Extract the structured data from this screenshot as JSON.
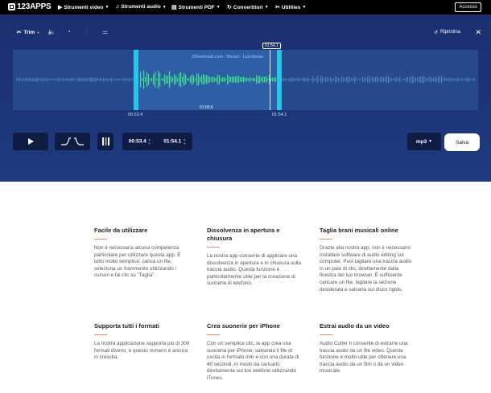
{
  "nav": {
    "logo": "123APPS",
    "items": [
      {
        "icon": "video-icon",
        "label": "Strumenti video"
      },
      {
        "icon": "audio-icon",
        "label": "Strumenti audio"
      },
      {
        "icon": "pdf-icon",
        "label": "Strumenti PDF"
      },
      {
        "icon": "convert-icon",
        "label": "Convertitori"
      },
      {
        "icon": "tools-icon",
        "label": "Utilities"
      }
    ],
    "login": "Accesso"
  },
  "toolbar": {
    "trim_label": "Trim",
    "trim_sup": "+",
    "reset_label": "Ripristina"
  },
  "wave": {
    "watermark": "XDownload.com - Mozart - Lacrimosa",
    "start": "00:53.4",
    "end": "01:54.1",
    "middle": "01:00.6",
    "cursor": "01:54.1"
  },
  "controls": {
    "start_time": "00:53.4",
    "end_time": "01:54.1",
    "format": "mp3",
    "save": "Salva"
  },
  "features": [
    {
      "title": "Facile da utilizzare",
      "text": "Non è necessaria alcuna competenza particolare per utilizzare questa app. È tutto molto semplice: carica un file, seleziona un frammento utilizzando i cursori e fai clic su \"Taglia\"."
    },
    {
      "title": "Dissolvenza in apertura e chiusura",
      "text": "La nostra app consente di applicare una dissolvenza in apertura e in chiusura sulla traccia audio. Questa funzione è particolarmente utile per la creazione di suonerie di telefono."
    },
    {
      "title": "Taglia brani musicali online",
      "text": "Grazie alla nostra app, non è necessario installare software di audio editing sul computer. Puoi tagliare una traccia audio in un paio di clic, direttamente dalla finestra del tuo browser. È sufficiente caricare un file, tagliare la sezione desiderata e salvarla sul disco rigido."
    },
    {
      "title": "Supporta tutti i formati",
      "text": "La nostra applicazione supporta più di 300 formati diversi; e questo numero è ancora in crescita."
    },
    {
      "title": "Crea suonerie per iPhone",
      "text": "Con un semplice clic, la app crea una suoneria per iPhone, salvando il file di uscita in formato m4r e con una durata di 40 secondi, in modo da caricarlo direttamente sul tuo telefono utilizzando iTunes."
    },
    {
      "title": "Estrai audio da un video",
      "text": "Audio Cutter ti consente di estrarre una traccia audio da un file video. Questa funzione è molto utile per ottenere una traccia audio da un film o da un video musicale."
    }
  ]
}
